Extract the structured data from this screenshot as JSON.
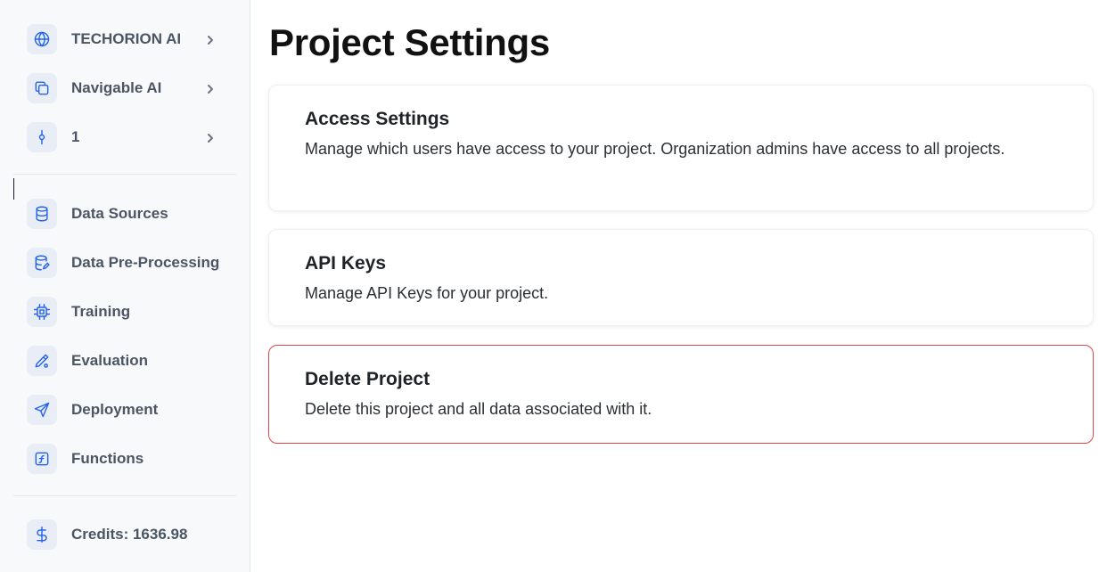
{
  "sidebar": {
    "top_items": [
      {
        "label": "TECHORION AI",
        "icon": "globe-icon"
      },
      {
        "label": "Navigable AI",
        "icon": "copy-icon"
      },
      {
        "label": "1",
        "icon": "git-commit-icon"
      }
    ],
    "nav_items": [
      {
        "label": "Data Sources",
        "icon": "database-icon"
      },
      {
        "label": "Data Pre-Processing",
        "icon": "database-edit-icon"
      },
      {
        "label": "Training",
        "icon": "cpu-icon"
      },
      {
        "label": "Evaluation",
        "icon": "brush-icon"
      },
      {
        "label": "Deployment",
        "icon": "send-icon"
      },
      {
        "label": "Functions",
        "icon": "function-icon"
      }
    ],
    "credits": {
      "label": "Credits: ",
      "value": "1636.98",
      "icon": "dollar-icon"
    }
  },
  "main": {
    "title": "Project Settings",
    "cards": [
      {
        "title": "Access Settings",
        "description": "Manage which users have access to your project. Organization admins have access to all projects."
      },
      {
        "title": "API Keys",
        "description": "Manage API Keys for your project."
      },
      {
        "title": "Delete Project",
        "description": "Delete this project and all data associated with it."
      }
    ]
  },
  "colors": {
    "accent": "#2563eb",
    "danger": "#e04848",
    "sidebar_bg": "#f8f9fb",
    "icon_bg": "#e8edf6"
  }
}
